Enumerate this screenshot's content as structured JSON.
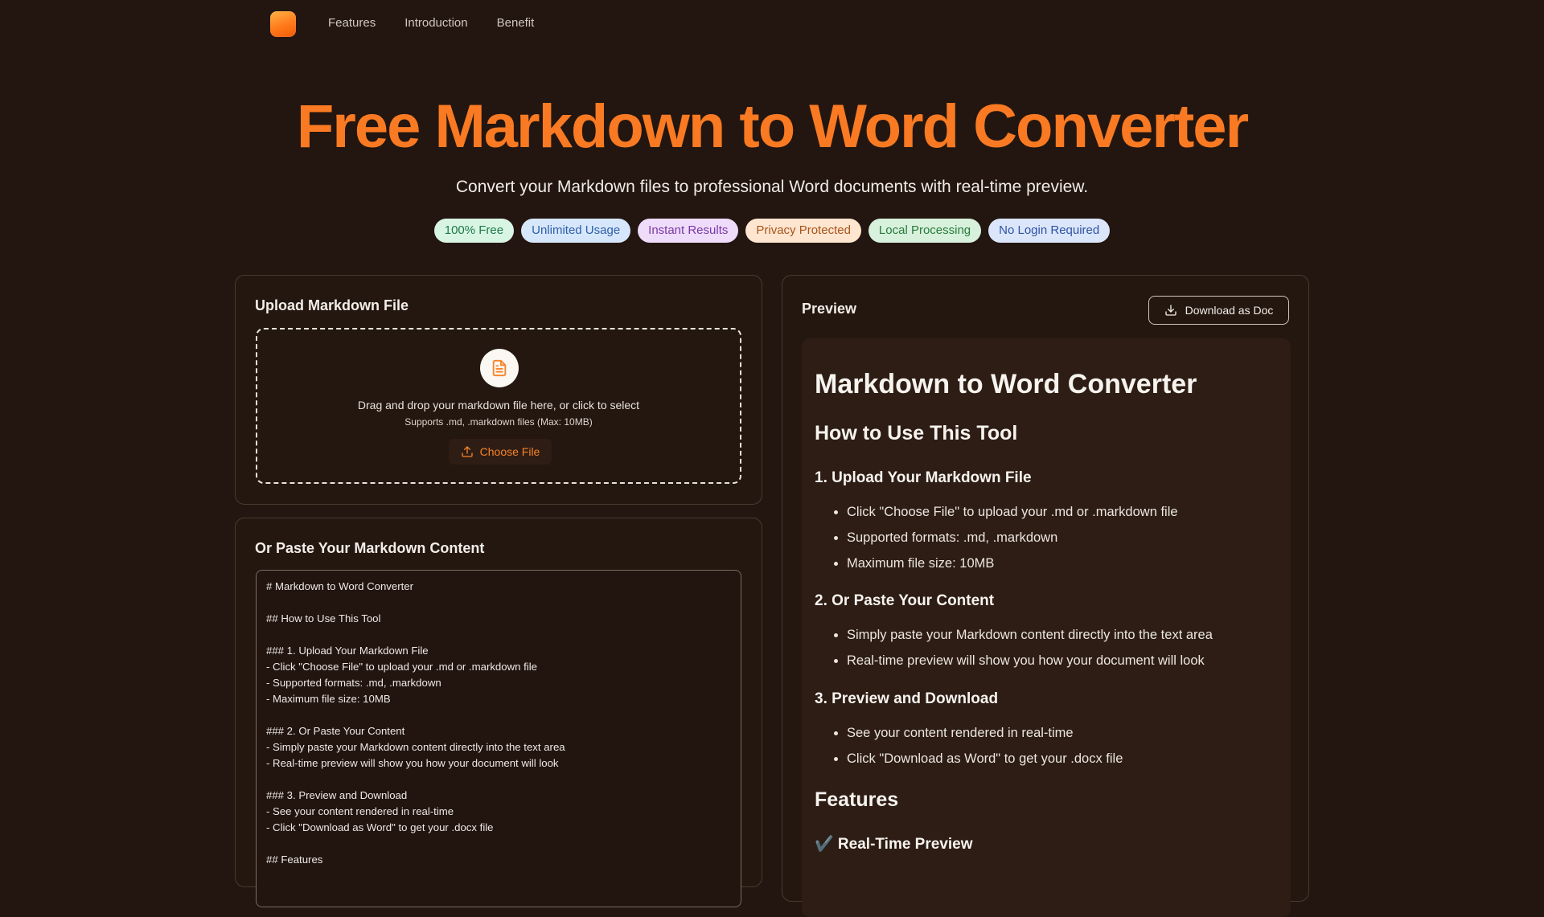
{
  "nav": {
    "links": [
      "Features",
      "Introduction",
      "Benefit"
    ]
  },
  "hero": {
    "title": "Free Markdown to Word Converter",
    "subtitle": "Convert your Markdown files to professional Word documents with real-time preview."
  },
  "badges": [
    {
      "label": "100% Free",
      "bg": "#d8f5e4",
      "fg": "#1f7a47"
    },
    {
      "label": "Unlimited Usage",
      "bg": "#d7e7fb",
      "fg": "#2e5fa8"
    },
    {
      "label": "Instant Results",
      "bg": "#eedcfa",
      "fg": "#7b3aa6"
    },
    {
      "label": "Privacy Protected",
      "bg": "#fde5cf",
      "fg": "#a8541a"
    },
    {
      "label": "Local Processing",
      "bg": "#d7f1dc",
      "fg": "#2a7a3c"
    },
    {
      "label": "No Login Required",
      "bg": "#dbe6fb",
      "fg": "#3052a3"
    }
  ],
  "upload": {
    "title": "Upload Markdown File",
    "drop_text": "Drag and drop your markdown file here, or click to select",
    "drop_hint": "Supports .md, .markdown files (Max: 10MB)",
    "choose_label": "Choose File"
  },
  "paste": {
    "title": "Or Paste Your Markdown Content",
    "content": "# Markdown to Word Converter\n\n## How to Use This Tool\n\n### 1. Upload Your Markdown File\n- Click \"Choose File\" to upload your .md or .markdown file\n- Supported formats: .md, .markdown\n- Maximum file size: 10MB\n\n### 2. Or Paste Your Content\n- Simply paste your Markdown content directly into the text area\n- Real-time preview will show you how your document will look\n\n### 3. Preview and Download\n- See your content rendered in real-time\n- Click \"Download as Word\" to get your .docx file\n\n## Features"
  },
  "preview": {
    "title": "Preview",
    "download_label": "Download as Doc",
    "h1": "Markdown to Word Converter",
    "h2_howto": "How to Use This Tool",
    "s1": {
      "heading": "1. Upload Your Markdown File",
      "items": [
        "Click \"Choose File\" to upload your .md or .markdown file",
        "Supported formats: .md, .markdown",
        "Maximum file size: 10MB"
      ]
    },
    "s2": {
      "heading": "2. Or Paste Your Content",
      "items": [
        "Simply paste your Markdown content directly into the text area",
        "Real-time preview will show you how your document will look"
      ]
    },
    "s3": {
      "heading": "3. Preview and Download",
      "items": [
        "See your content rendered in real-time",
        "Click \"Download as Word\" to get your .docx file"
      ]
    },
    "h2_features": "Features",
    "h3_realtime": "✔️ Real-Time Preview"
  }
}
